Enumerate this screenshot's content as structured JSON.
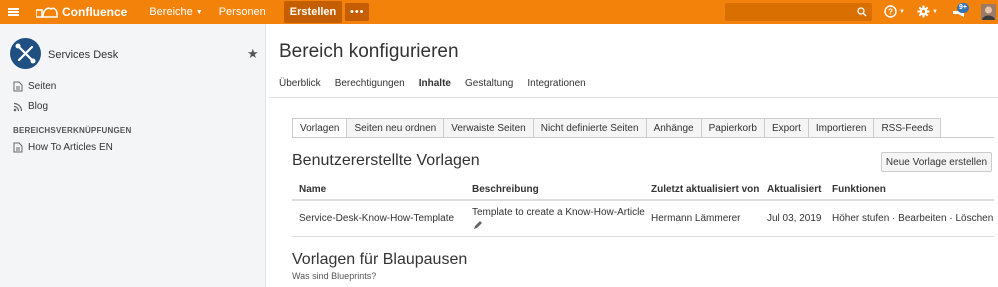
{
  "topbar": {
    "app_name": "Confluence",
    "nav": [
      "Bereiche",
      "Personen"
    ],
    "create_label": "Erstellen",
    "more_label": "•••",
    "notification_count": "9+",
    "colors": {
      "bar": "#f2820a",
      "create_bg": "#c55e00",
      "badge": "#3572b0"
    }
  },
  "sidebar": {
    "space_name": "Services Desk",
    "links": [
      "Seiten",
      "Blog"
    ],
    "shortcuts_heading": "BEREICHSVERKNÜPFUNGEN",
    "shortcut_item": "How To Articles EN"
  },
  "main": {
    "title": "Bereich konfigurieren",
    "tabs": [
      "Überblick",
      "Berechtigungen",
      "Inhalte",
      "Gestaltung",
      "Integrationen"
    ],
    "active_tab": "Inhalte",
    "subtabs": [
      "Vorlagen",
      "Seiten neu ordnen",
      "Verwaiste Seiten",
      "Nicht definierte Seiten",
      "Anhänge",
      "Papierkorb",
      "Export",
      "Importieren",
      "RSS-Feeds"
    ],
    "user_templates_title": "Benutzererstellte Vorlagen",
    "new_template_button": "Neue Vorlage erstellen",
    "table": {
      "headers": [
        "Name",
        "Beschreibung",
        "Zuletzt aktualisiert von",
        "Aktualisiert",
        "Funktionen"
      ],
      "rows": [
        {
          "name": "Service-Desk-Know-How-Template",
          "description": "Template to create a Know-How-Article",
          "updated_by": "Hermann Lämmerer",
          "updated": "Jul 03, 2019",
          "actions": [
            "Höher stufen",
            "Bearbeiten",
            "Löschen"
          ],
          "separator": "·"
        }
      ]
    },
    "blueprints_title": "Vorlagen für Blaupausen",
    "blueprints_subtitle": "Was sind Blueprints?"
  }
}
